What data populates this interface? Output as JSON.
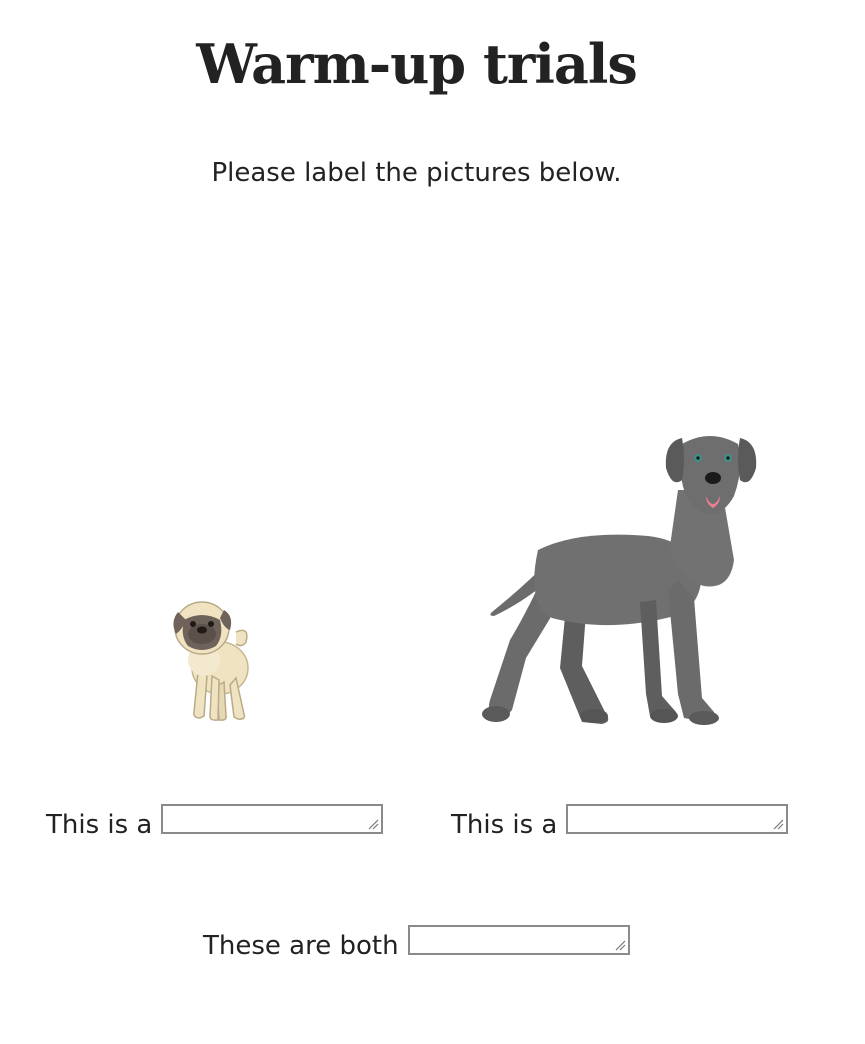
{
  "page": {
    "title": "Warm-up trials",
    "instructions": "Please label the pictures below."
  },
  "trial": {
    "left_label": "This is a",
    "left_answer": "",
    "right_label": "This is a",
    "right_answer": "",
    "both_label": "These are both",
    "both_answer": ""
  },
  "images": {
    "left": "pug-illustration",
    "right": "great-dane-illustration"
  },
  "colors": {
    "text": "#222222",
    "input_border": "#8a8a8a",
    "dane_body": "#6b6b6b",
    "pug_body": "#efe3c2",
    "pug_face": "#6e625a"
  }
}
